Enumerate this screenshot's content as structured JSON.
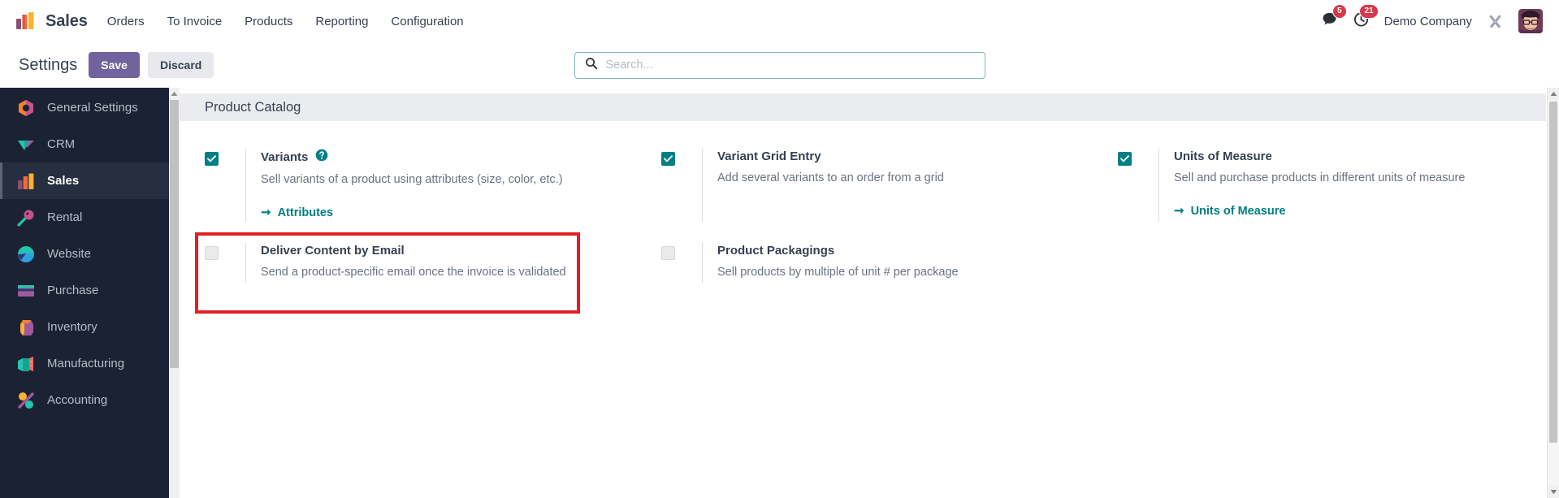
{
  "navbar": {
    "brand": "Sales",
    "brand_icon": "sales-app-icon",
    "menu_items": [
      {
        "label": "Orders",
        "name": "menu-orders"
      },
      {
        "label": "To Invoice",
        "name": "menu-to-invoice"
      },
      {
        "label": "Products",
        "name": "menu-products"
      },
      {
        "label": "Reporting",
        "name": "menu-reporting"
      },
      {
        "label": "Configuration",
        "name": "menu-configuration"
      }
    ],
    "messages_badge": "5",
    "activities_badge": "21",
    "company": "Demo Company",
    "messages_icon": "chat-bubble-icon",
    "activities_icon": "clock-icon",
    "tools_icon": "tools-icon",
    "avatar_icon": "user-avatar"
  },
  "control_panel": {
    "title": "Settings",
    "save_label": "Save",
    "discard_label": "Discard",
    "search_placeholder": "Search...",
    "search_value": "",
    "search_icon": "search-icon"
  },
  "sidebar": {
    "items": [
      {
        "label": "General Settings",
        "name": "sidebar-item-general-settings",
        "active": false
      },
      {
        "label": "CRM",
        "name": "sidebar-item-crm",
        "active": false
      },
      {
        "label": "Sales",
        "name": "sidebar-item-sales",
        "active": true
      },
      {
        "label": "Rental",
        "name": "sidebar-item-rental",
        "active": false
      },
      {
        "label": "Website",
        "name": "sidebar-item-website",
        "active": false
      },
      {
        "label": "Purchase",
        "name": "sidebar-item-purchase",
        "active": false
      },
      {
        "label": "Inventory",
        "name": "sidebar-item-inventory",
        "active": false
      },
      {
        "label": "Manufacturing",
        "name": "sidebar-item-manufacturing",
        "active": false
      },
      {
        "label": "Accounting",
        "name": "sidebar-item-accounting",
        "active": false
      }
    ]
  },
  "main": {
    "section_title": "Product Catalog",
    "settings": [
      {
        "name": "setting-variants",
        "label": "Variants",
        "description": "Sell variants of a product using attributes (size, color, etc.)",
        "checked": true,
        "has_help": true,
        "link": "Attributes",
        "link_name": "link-attributes",
        "column": "left",
        "highlighted": false
      },
      {
        "name": "setting-variant-grid-entry",
        "label": "Variant Grid Entry",
        "description": "Add several variants to an order from a grid",
        "checked": true,
        "has_help": false,
        "link": null,
        "link_name": null,
        "column": "right",
        "highlighted": false
      },
      {
        "name": "setting-units-of-measure",
        "label": "Units of Measure",
        "description": "Sell and purchase products in different units of measure",
        "checked": true,
        "has_help": false,
        "link": "Units of Measure",
        "link_name": "link-units-of-measure",
        "column": "left",
        "highlighted": true
      },
      {
        "name": "setting-deliver-content-by-email",
        "label": "Deliver Content by Email",
        "description": "Send a product-specific email once the invoice is validated",
        "checked": false,
        "has_help": false,
        "link": null,
        "link_name": null,
        "column": "right",
        "highlighted": false
      },
      {
        "name": "setting-product-packagings",
        "label": "Product Packagings",
        "description": "Sell products by multiple of unit # per package",
        "checked": false,
        "has_help": false,
        "link": null,
        "link_name": null,
        "column": "left",
        "highlighted": false
      }
    ]
  },
  "annotation": {
    "type": "highlight-rectangle",
    "color": "#e31e24",
    "target": "setting-units-of-measure"
  },
  "colors": {
    "accent_teal": "#017e84",
    "save_purple": "#71639e",
    "sidebar_bg": "#1b2233",
    "badge_red": "#d6384e",
    "annotation_red": "#e31e24"
  }
}
